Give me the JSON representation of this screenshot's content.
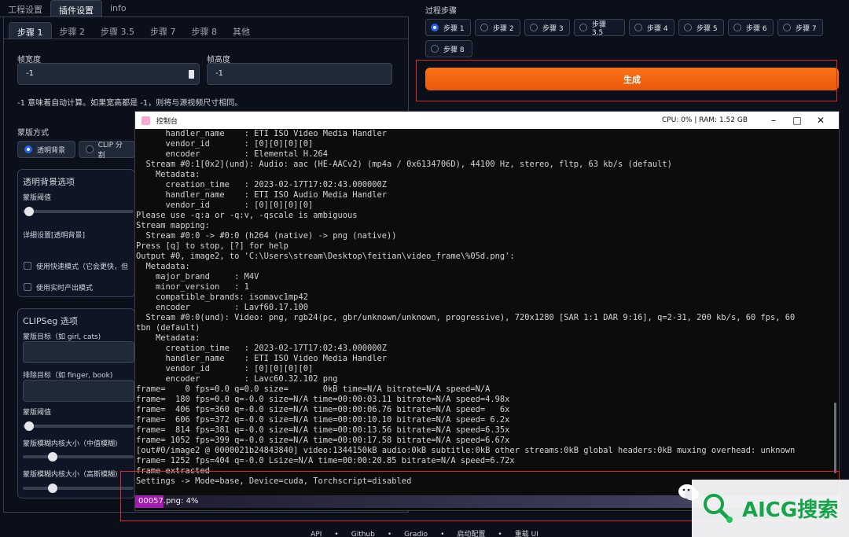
{
  "top_tabs": [
    "工程设置",
    "插件设置",
    "info"
  ],
  "sub_tabs": [
    "步骤 1",
    "步骤 2",
    "步骤 3.5",
    "步骤 7",
    "步骤 8",
    "其他"
  ],
  "frame_width": {
    "label": "帧宽度",
    "value": "-1"
  },
  "frame_height": {
    "label": "帧高度",
    "value": "-1"
  },
  "auto_note": "-1 意味着自动计算。如果宽高都是 -1，则将与源视频尺寸相同。",
  "mask_mode": {
    "label": "蒙版方式",
    "options": [
      "透明背景",
      "CLIP 分割"
    ],
    "selected": "透明背景"
  },
  "transparent_group": {
    "title": "透明背景选项",
    "threshold_label": "蒙版阈值",
    "detail_label": "详细设置[透明背景]",
    "fast_mode": "使用快速模式（它会更快，但",
    "realtime_mode": "使用实时产出模式"
  },
  "clipseg_group": {
    "title": "CLIPSeg 选项",
    "target_label": "蒙版目标（如 girl, cats)",
    "exclude_label": "排除目标（如 finger, book)",
    "threshold_label": "蒙版阈值",
    "median_blur_label": "蒙版模糊内核大小（中值模糊)",
    "gauss_blur_label": "蒙版模糊内核大小（高斯模糊)"
  },
  "process_steps": {
    "label": "过程步骤",
    "steps": [
      "步骤 1",
      "步骤 2",
      "步骤 3",
      "步骤 3.5",
      "步骤 4",
      "步骤 5",
      "步骤 6",
      "步骤 7",
      "步骤 8"
    ],
    "selected": "步骤 1"
  },
  "generate_button": "生成",
  "console": {
    "title": "控制台",
    "stats": "CPU: 0% | RAM: 1.52 GB",
    "lines": [
      "      handler_name    : ETI ISO Video Media Handler",
      "      vendor_id       : [0][0][0][0]",
      "      encoder         : Elemental H.264",
      "  Stream #0:1[0x2](und): Audio: aac (HE-AACv2) (mp4a / 0x6134706D), 44100 Hz, stereo, fltp, 63 kb/s (default)",
      "    Metadata:",
      "      creation_time   : 2023-02-17T17:02:43.000000Z",
      "      handler_name    : ETI ISO Audio Media Handler",
      "      vendor_id       : [0][0][0][0]",
      "Please use -q:a or -q:v, -qscale is ambiguous",
      "Stream mapping:",
      "  Stream #0:0 -> #0:0 (h264 (native) -> png (native))",
      "Press [q] to stop, [?] for help",
      "Output #0, image2, to 'C:\\Users\\stream\\Desktop\\feitian\\video_frame\\%05d.png':",
      "  Metadata:",
      "    major_brand     : M4V",
      "    minor_version   : 1",
      "    compatible_brands: isomavc1mp42",
      "    encoder         : Lavf60.17.100",
      "  Stream #0:0(und): Video: png, rgb24(pc, gbr/unknown/unknown, progressive), 720x1280 [SAR 1:1 DAR 9:16], q=2-31, 200 kb/s, 60 fps, 60",
      "tbn (default)",
      "    Metadata:",
      "      creation_time   : 2023-02-17T17:02:43.000000Z",
      "      handler_name    : ETI ISO Video Media Handler",
      "      vendor_id       : [0][0][0][0]",
      "      encoder         : Lavc60.32.102 png",
      "frame=    0 fps=0.0 q=0.0 size=       0kB time=N/A bitrate=N/A speed=N/A",
      "frame=  180 fps=0.0 q=-0.0 size=N/A time=00:00:03.11 bitrate=N/A speed=4.98x",
      "frame=  406 fps=360 q=-0.0 size=N/A time=00:00:06.76 bitrate=N/A speed=   6x",
      "frame=  606 fps=372 q=-0.0 size=N/A time=00:00:10.10 bitrate=N/A speed= 6.2x",
      "frame=  814 fps=381 q=-0.0 size=N/A time=00:00:13.56 bitrate=N/A speed=6.35x",
      "frame= 1052 fps=399 q=-0.0 size=N/A time=00:00:17.58 bitrate=N/A speed=6.67x",
      "[out#0/image2 @ 0000021b24843840] video:1344150kB audio:0kB subtitle:0kB other streams:0kB global headers:0kB muxing overhead: unknown",
      "frame= 1252 fps=404 q=-0.0 Lsize=N/A time=00:00:20.85 bitrate=N/A speed=6.72x",
      "frame extracted",
      "Settings -> Mode=base, Device=cuda, Torchscript=disabled"
    ],
    "progress_text": "00057.png: 4%",
    "progress_fraction": 0.04
  },
  "footer": [
    "API",
    "Github",
    "Gradio",
    "启动配置",
    "重载 UI"
  ],
  "footer_separator": "•",
  "watermark_text": "AICG搜索"
}
